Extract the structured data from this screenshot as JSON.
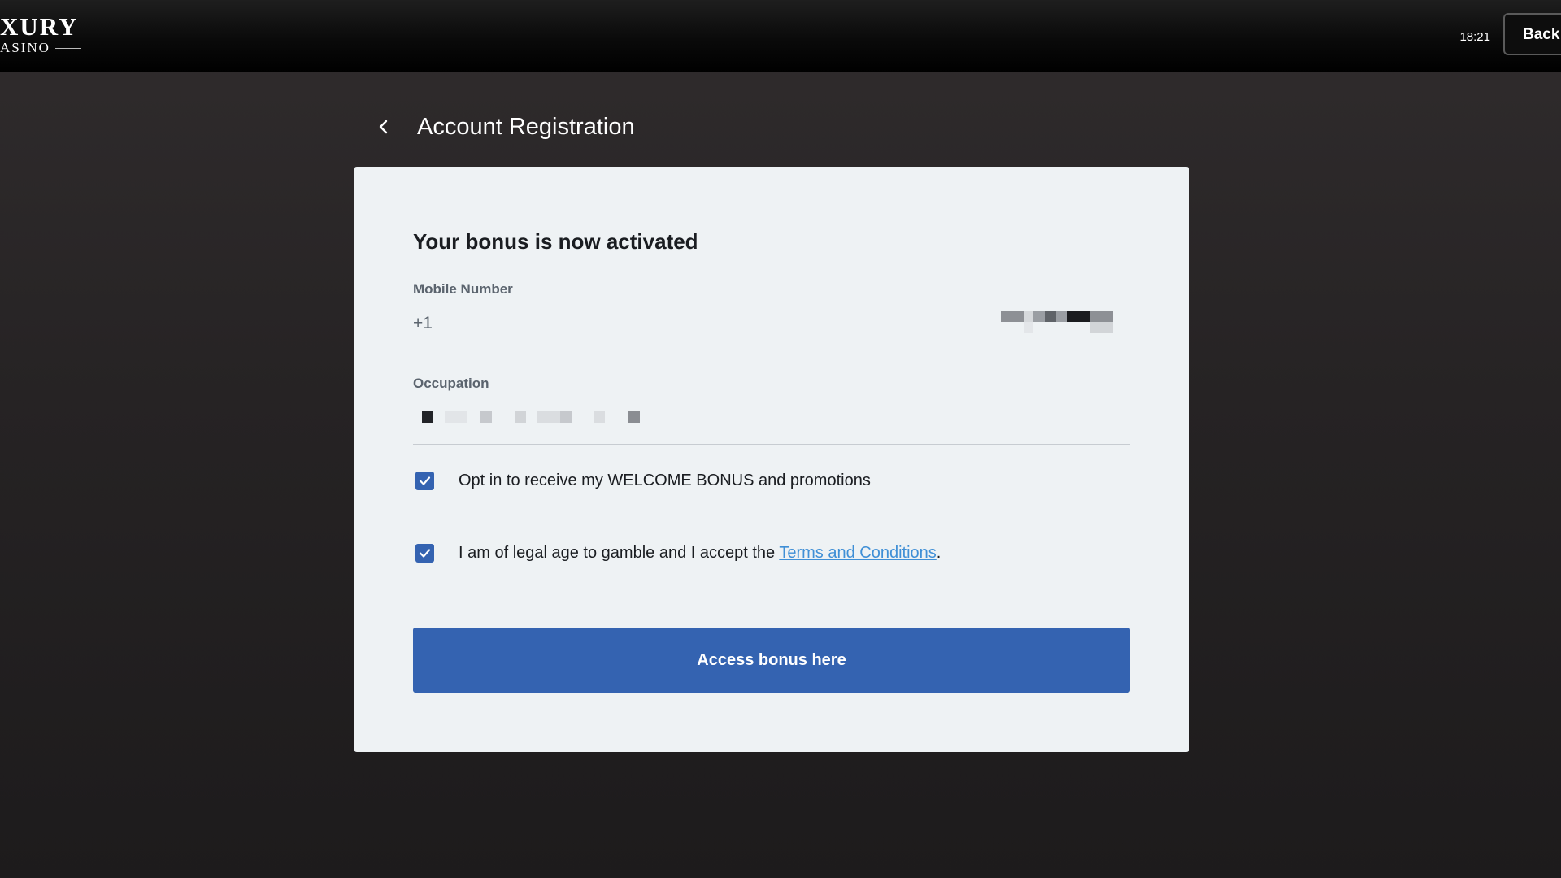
{
  "header": {
    "logo_main": "XURY",
    "logo_sub": "ASINO",
    "clock": "18:21",
    "back_label": "Back"
  },
  "page": {
    "title": "Account Registration"
  },
  "card": {
    "title": "Your bonus is now activated",
    "mobile": {
      "label": "Mobile Number",
      "prefix": "+1"
    },
    "occupation": {
      "label": "Occupation"
    },
    "checkboxes": [
      {
        "label": "Opt in to receive my WELCOME BONUS and promotions",
        "checked": true
      },
      {
        "label_before": "I am of legal age to gamble and I accept the ",
        "link_text": "Terms and Conditions",
        "label_after": ".",
        "checked": true
      }
    ],
    "cta_label": "Access bonus here"
  },
  "colors": {
    "primary_button": "#3463b1",
    "link": "#3f8fd6",
    "card_bg": "#eef2f4"
  }
}
